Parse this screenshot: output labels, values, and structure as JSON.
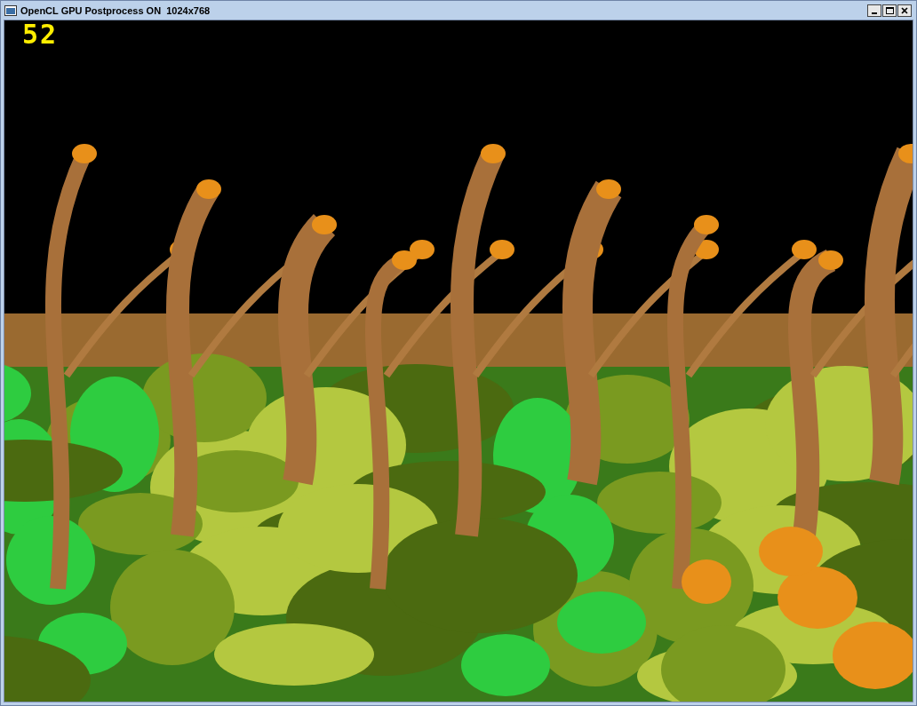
{
  "window": {
    "title": "OpenCL GPU Postprocess ON  1024x768"
  },
  "viewport": {
    "fps": "52"
  }
}
